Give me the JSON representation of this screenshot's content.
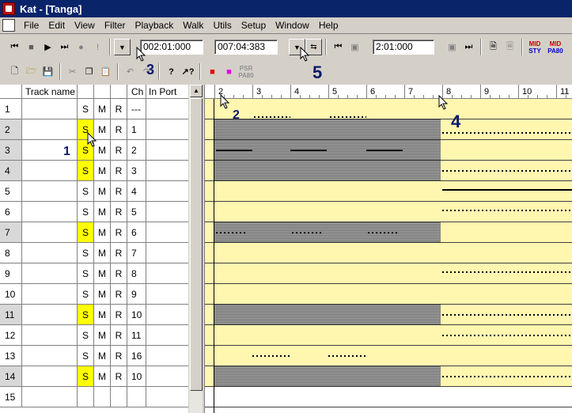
{
  "window": {
    "title": "Kat - [Tanga]"
  },
  "menu": [
    "File",
    "Edit",
    "View",
    "Filter",
    "Playback",
    "Walk",
    "Utils",
    "Setup",
    "Window",
    "Help"
  ],
  "toolbar1": {
    "time_from": "002:01:000",
    "time_to": "007:04:383",
    "loop_time": "2:01:000",
    "midi1": [
      "MID",
      "STY"
    ],
    "midi2": [
      "MID",
      "PA80"
    ]
  },
  "toolbar2": {
    "psr": [
      "PSR",
      "PA80"
    ]
  },
  "tracklist": {
    "headers": {
      "name": "Track name",
      "s": "",
      "m": "",
      "r": "",
      "ch": "Ch",
      "port": "In Port"
    },
    "rows": [
      {
        "num": "1",
        "s": "S",
        "m": "M",
        "r": "R",
        "ch": "---",
        "solo": false,
        "sel": false
      },
      {
        "num": "2",
        "s": "S",
        "m": "M",
        "r": "R",
        "ch": "1",
        "solo": true,
        "sel": true
      },
      {
        "num": "3",
        "s": "S",
        "m": "M",
        "r": "R",
        "ch": "2",
        "solo": true,
        "sel": true
      },
      {
        "num": "4",
        "s": "S",
        "m": "M",
        "r": "R",
        "ch": "3",
        "solo": true,
        "sel": true
      },
      {
        "num": "5",
        "s": "S",
        "m": "M",
        "r": "R",
        "ch": "4",
        "solo": false,
        "sel": false
      },
      {
        "num": "6",
        "s": "S",
        "m": "M",
        "r": "R",
        "ch": "5",
        "solo": false,
        "sel": false
      },
      {
        "num": "7",
        "s": "S",
        "m": "M",
        "r": "R",
        "ch": "6",
        "solo": true,
        "sel": true
      },
      {
        "num": "8",
        "s": "S",
        "m": "M",
        "r": "R",
        "ch": "7",
        "solo": false,
        "sel": false
      },
      {
        "num": "9",
        "s": "S",
        "m": "M",
        "r": "R",
        "ch": "8",
        "solo": false,
        "sel": false
      },
      {
        "num": "10",
        "s": "S",
        "m": "M",
        "r": "R",
        "ch": "9",
        "solo": false,
        "sel": false
      },
      {
        "num": "11",
        "s": "S",
        "m": "M",
        "r": "R",
        "ch": "10",
        "solo": true,
        "sel": true
      },
      {
        "num": "12",
        "s": "S",
        "m": "M",
        "r": "R",
        "ch": "11",
        "solo": false,
        "sel": false
      },
      {
        "num": "13",
        "s": "S",
        "m": "M",
        "r": "R",
        "ch": "16",
        "solo": false,
        "sel": false
      },
      {
        "num": "14",
        "s": "S",
        "m": "M",
        "r": "R",
        "ch": "10",
        "solo": true,
        "sel": true
      },
      {
        "num": "15",
        "s": "",
        "m": "",
        "r": "",
        "ch": "",
        "solo": false,
        "sel": false
      }
    ]
  },
  "ruler": {
    "measures": [
      "2",
      "3",
      "4",
      "5",
      "6",
      "7",
      "8",
      "9",
      "10",
      "11"
    ]
  },
  "annotations": {
    "a1": "1",
    "a2": "2",
    "a3": "3",
    "a4": "4",
    "a5": "5"
  },
  "colors": {
    "solo": "#ffff00",
    "lane": "#fff6b0",
    "title_bar": "#0a246a"
  }
}
